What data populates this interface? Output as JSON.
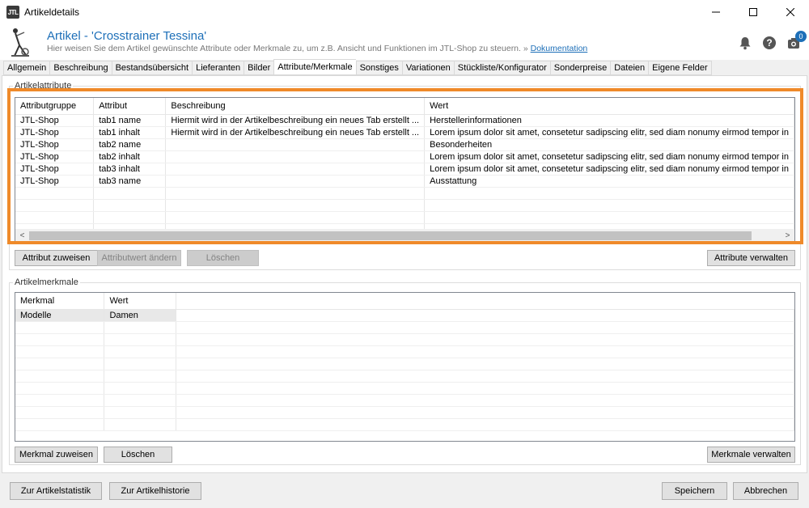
{
  "window": {
    "logo": "JTL",
    "title": "Artikeldetails",
    "minimize_icon": "minimize-icon",
    "maximize_icon": "maximize-icon",
    "close_icon": "close-icon"
  },
  "header": {
    "title": "Artikel - 'Crosstrainer Tessina'",
    "subtitle": "Hier weisen Sie dem Artikel gewünschte Attribute oder Merkmale zu, um z.B. Ansicht und Funktionen im JTL-Shop zu steuern. »",
    "doc_link": "Dokumentation",
    "badge_count": "0",
    "accent_color": "#1d6fb8"
  },
  "tabs": [
    {
      "label": "Allgemein"
    },
    {
      "label": "Beschreibung"
    },
    {
      "label": "Bestandsübersicht"
    },
    {
      "label": "Lieferanten"
    },
    {
      "label": "Bilder"
    },
    {
      "label": "Attribute/Merkmale",
      "active": true
    },
    {
      "label": "Sonstiges"
    },
    {
      "label": "Variationen"
    },
    {
      "label": "Stückliste/Konfigurator"
    },
    {
      "label": "Sonderpreise"
    },
    {
      "label": "Dateien"
    },
    {
      "label": "Eigene Felder"
    }
  ],
  "attributes": {
    "group_label": "Artikelattribute",
    "columns": [
      "Attributgruppe",
      "Attribut",
      "Beschreibung",
      "Wert"
    ],
    "rows": [
      [
        "JTL-Shop",
        "tab1 name",
        "Hiermit wird in der Artikelbeschreibung ein neues Tab erstellt ...",
        "Herstellerinformationen"
      ],
      [
        "JTL-Shop",
        "tab1 inhalt",
        "Hiermit wird in der Artikelbeschreibung ein neues Tab erstellt ...",
        "Lorem ipsum dolor sit amet, consetetur sadipscing elitr, sed diam nonumy eirmod tempor in"
      ],
      [
        "JTL-Shop",
        "tab2 name",
        "",
        "Besonderheiten"
      ],
      [
        "JTL-Shop",
        "tab2 inhalt",
        "",
        "Lorem ipsum dolor sit amet, consetetur sadipscing elitr, sed diam nonumy eirmod tempor in"
      ],
      [
        "JTL-Shop",
        "tab3 inhalt",
        "",
        "Lorem ipsum dolor sit amet, consetetur sadipscing elitr, sed diam nonumy eirmod tempor in"
      ],
      [
        "JTL-Shop",
        "tab3 name",
        "",
        "Ausstattung"
      ]
    ],
    "scroll_left": "<",
    "scroll_right": ">",
    "buttons": {
      "assign": "Attribut zuweisen",
      "change_value": "Attributwert ändern",
      "delete": "Löschen",
      "manage": "Attribute verwalten"
    },
    "highlight_color": "#ef8a2a"
  },
  "features": {
    "group_label": "Artikelmerkmale",
    "columns": [
      "Merkmal",
      "Wert"
    ],
    "rows": [
      [
        "Modelle",
        "Damen"
      ]
    ],
    "buttons": {
      "assign": "Merkmal zuweisen",
      "delete": "Löschen",
      "manage": "Merkmale verwalten"
    }
  },
  "footer": {
    "statistics": "Zur Artikelstatistik",
    "history": "Zur Artikelhistorie",
    "save": "Speichern",
    "cancel": "Abbrechen"
  }
}
